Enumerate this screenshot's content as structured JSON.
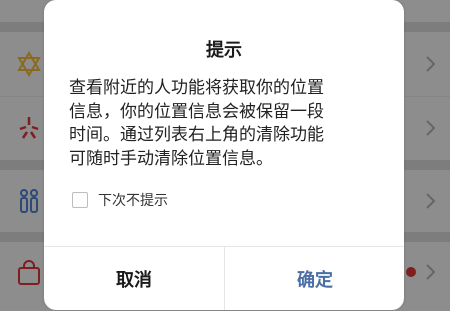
{
  "background": {
    "rows": [
      {
        "icon": "partial-icon",
        "has_chevron": false
      },
      {
        "icon": "star-of-david-icon",
        "has_chevron": true
      },
      {
        "icon": "sparkle-icon",
        "has_chevron": true
      },
      {
        "icon": "people-icon",
        "has_chevron": true
      },
      {
        "icon": "shopping-bag-icon",
        "has_chevron": true,
        "has_badge_dot": true
      }
    ]
  },
  "dialog": {
    "title": "提示",
    "message_lines": [
      "查看附近的人功能将获取你的位置",
      "信息，你的位置信息会被保留一段",
      "时间。通过列表右上角的清除功能",
      "可随时手动清除位置信息。"
    ],
    "checkbox_label": "下次不提示",
    "checkbox_checked": false,
    "cancel_label": "取消",
    "ok_label": "确定"
  },
  "colors": {
    "ok_text": "#4a6fa5",
    "badge_dot": "#c0392b"
  }
}
